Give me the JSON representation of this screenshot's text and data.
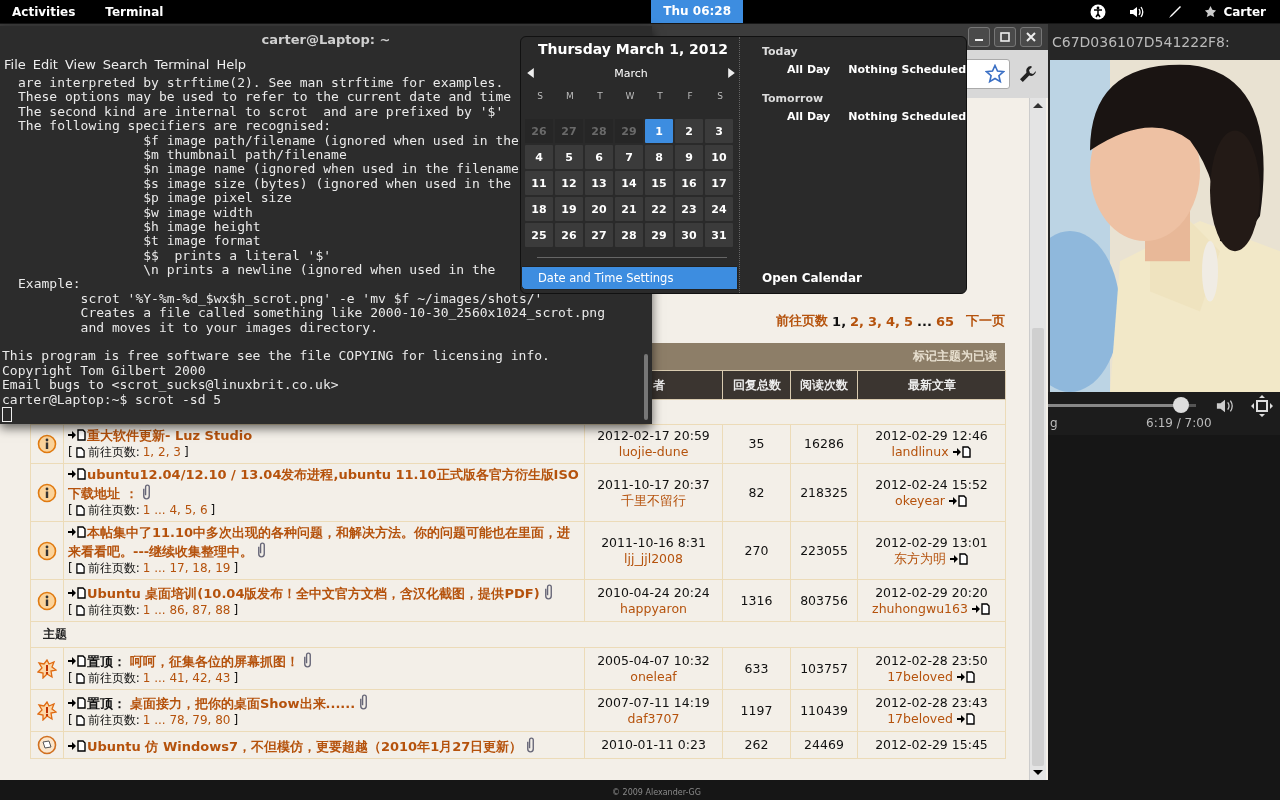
{
  "top_bar": {
    "activities": "Activities",
    "app": "Terminal",
    "clock": {
      "label": "Thu 06:28",
      "selected": true
    },
    "user": "Carter"
  },
  "terminal": {
    "title": "carter@Laptop: ~",
    "menu": [
      "File",
      "Edit",
      "View",
      "Search",
      "Terminal",
      "Help"
    ],
    "lines": [
      "are interpreted by strftime(2). See man strftime for examples.",
      "These options may be used to refer to the current date and time",
      "The second kind are internal to scrot  and are prefixed by '$'",
      "The following specifiers are recognised:",
      "                $f image path/filename (ignored when used in the",
      "                $m thumbnail path/filename",
      "                $n image name (ignored when used in the filename",
      "                $s image size (bytes) (ignored when used in the",
      "                $p image pixel size",
      "                $w image width",
      "                $h image height",
      "                $t image format",
      "                $$  prints a literal '$'",
      "                \\n prints a newline (ignored when used in the",
      "Example:",
      "        scrot '%Y-%m-%d_$wx$h_scrot.png' -e 'mv $f ~/images/shots/'",
      "        Creates a file called something like 2000-10-30_2560x1024_scrot.png",
      "        and moves it to your images directory."
    ],
    "footer_lines": [
      "This program is free software see the file COPYING for licensing info.",
      "Copyright Tom Gilbert 2000",
      "Email bugs to <scrot_sucks@linuxbrit.co.uk>"
    ],
    "prompt": "carter@Laptop:~$ scrot -sd 5"
  },
  "calendar": {
    "title": "Thursday March  1, 2012",
    "month": "March",
    "weekdays": [
      "S",
      "M",
      "T",
      "W",
      "T",
      "F",
      "S"
    ],
    "weeks": [
      [
        {
          "day": "26",
          "other_month": true,
          "selected": false
        },
        {
          "day": "27",
          "other_month": true,
          "selected": false
        },
        {
          "day": "28",
          "other_month": true,
          "selected": false
        },
        {
          "day": "29",
          "other_month": true,
          "selected": false
        },
        {
          "day": "1",
          "other_month": false,
          "selected": true
        },
        {
          "day": "2",
          "other_month": false,
          "selected": false
        },
        {
          "day": "3",
          "other_month": false,
          "selected": false
        }
      ],
      [
        {
          "day": "4",
          "other_month": false,
          "selected": false
        },
        {
          "day": "5",
          "other_month": false,
          "selected": false
        },
        {
          "day": "6",
          "other_month": false,
          "selected": false
        },
        {
          "day": "7",
          "other_month": false,
          "selected": false
        },
        {
          "day": "8",
          "other_month": false,
          "selected": false
        },
        {
          "day": "9",
          "other_month": false,
          "selected": false
        },
        {
          "day": "10",
          "other_month": false,
          "selected": false
        }
      ],
      [
        {
          "day": "11",
          "other_month": false,
          "selected": false
        },
        {
          "day": "12",
          "other_month": false,
          "selected": false
        },
        {
          "day": "13",
          "other_month": false,
          "selected": false
        },
        {
          "day": "14",
          "other_month": false,
          "selected": false
        },
        {
          "day": "15",
          "other_month": false,
          "selected": false
        },
        {
          "day": "16",
          "other_month": false,
          "selected": false
        },
        {
          "day": "17",
          "other_month": false,
          "selected": false
        }
      ],
      [
        {
          "day": "18",
          "other_month": false,
          "selected": false
        },
        {
          "day": "19",
          "other_month": false,
          "selected": false
        },
        {
          "day": "20",
          "other_month": false,
          "selected": false
        },
        {
          "day": "21",
          "other_month": false,
          "selected": false
        },
        {
          "day": "22",
          "other_month": false,
          "selected": false
        },
        {
          "day": "23",
          "other_month": false,
          "selected": false
        },
        {
          "day": "24",
          "other_month": false,
          "selected": false
        }
      ],
      [
        {
          "day": "25",
          "other_month": false,
          "selected": false
        },
        {
          "day": "26",
          "other_month": false,
          "selected": false
        },
        {
          "day": "27",
          "other_month": false,
          "selected": false
        },
        {
          "day": "28",
          "other_month": false,
          "selected": false
        },
        {
          "day": "29",
          "other_month": false,
          "selected": false
        },
        {
          "day": "30",
          "other_month": false,
          "selected": false
        },
        {
          "day": "31",
          "other_month": false,
          "selected": false
        }
      ]
    ],
    "settings_button": {
      "label": "Date and Time Settings",
      "selected": true
    },
    "events": [
      {
        "heading": "Today",
        "time": "All Day",
        "text": "Nothing Scheduled"
      },
      {
        "heading": "Tomorrow",
        "time": "All Day",
        "text": "Nothing Scheduled"
      }
    ],
    "open_calendar": "Open Calendar"
  },
  "forum": {
    "pagination": {
      "label": "前往页数",
      "pages": [
        {
          "text": "1,",
          "selected": true
        },
        {
          "text": "2,",
          "selected": false
        },
        {
          "text": "3,",
          "selected": false
        },
        {
          "text": "4,",
          "selected": false
        },
        {
          "text": "5",
          "selected": false
        }
      ],
      "ellipsis": "...",
      "last": "65",
      "next": "下一页"
    },
    "mark_read": "标记主题为已读",
    "columns": [
      "者",
      "回复总数",
      "阅读次数",
      "最新文章"
    ],
    "rows": [
      {
        "kind": "announcement",
        "title": "重大软件更新- Luz Studio",
        "attachment": false,
        "pages": {
          "open": "[",
          "label": "前往页数:",
          "links": "1, 2, 3",
          "close": "]"
        },
        "date": "2012-02-17 20:59",
        "author": "luojie-dune",
        "replies": "35",
        "views": "16286",
        "last_date": "2012-02-29 12:46",
        "last_author": "landlinux"
      },
      {
        "kind": "announcement",
        "title": "ubuntu12.04/12.10 / 13.04发布进程,ubuntu 11.10正式版各官方衍生版ISO下载地址 ：",
        "attachment": true,
        "pages": {
          "open": "[",
          "label": "前往页数:",
          "links": "1 ... 4, 5, 6",
          "close": "]"
        },
        "date": "2011-10-17 20:37",
        "author": "千里不留行",
        "replies": "82",
        "views": "218325",
        "last_date": "2012-02-24 15:52",
        "last_author": "okeyear"
      },
      {
        "kind": "announcement",
        "title": "本帖集中了11.10中多次出现的各种问题，和解决方法。你的问题可能也在里面，进来看看吧。---继续收集整理中。",
        "attachment": true,
        "pages": {
          "open": "[",
          "label": "前往页数:",
          "links": "1 ... 17, 18, 19",
          "close": "]"
        },
        "date": "2011-10-16 8:31",
        "author": "ljj_jjl2008",
        "replies": "270",
        "views": "223055",
        "last_date": "2012-02-29 13:01",
        "last_author": "东方为明"
      },
      {
        "kind": "announcement",
        "title": "Ubuntu 桌面培训(10.04版发布！全中文官方文档，含汉化截图，提供PDF)",
        "attachment": true,
        "pages": {
          "open": "[",
          "label": "前往页数:",
          "links": "1 ... 86, 87, 88",
          "close": "]"
        },
        "date": "2010-04-24 20:24",
        "author": "happyaron",
        "replies": "1316",
        "views": "803756",
        "last_date": "2012-02-29 20:20",
        "last_author": "zhuhongwu163"
      },
      {
        "kind": "section",
        "title": "主题"
      },
      {
        "kind": "sticky",
        "prefix": "置顶：",
        "title": "呵呵，征集各位的屏幕抓图！",
        "attachment": true,
        "pages": {
          "open": "[",
          "label": "前往页数:",
          "links": "1 ... 41, 42, 43",
          "close": "]"
        },
        "date": "2005-04-07 10:32",
        "author": "oneleaf",
        "replies": "633",
        "views": "103757",
        "last_date": "2012-02-28 23:50",
        "last_author": "17beloved"
      },
      {
        "kind": "sticky",
        "prefix": "置顶：",
        "title": "桌面接力，把你的桌面Show出来......",
        "attachment": true,
        "pages": {
          "open": "[",
          "label": "前往页数:",
          "links": "1 ... 78, 79, 80",
          "close": "]"
        },
        "date": "2007-07-11 14:19",
        "author": "daf3707",
        "replies": "1197",
        "views": "110439",
        "last_date": "2012-02-28 23:43",
        "last_author": "17beloved"
      },
      {
        "kind": "topic",
        "title": "Ubuntu 仿 Windows7，不但模仿，更要超越（2010年1月27日更新）",
        "attachment": true,
        "date": "2010-01-11 0:23",
        "replies": "262",
        "views": "24469",
        "last_date": "2012-02-29 15:45"
      }
    ]
  },
  "video": {
    "title": "C67D036107D541222F8:",
    "seek": {
      "level": 0.9
    },
    "time": "6:19 / 7:00",
    "side_text": "g"
  },
  "wallpaper_credit": "© 2009 Alexander-GG"
}
